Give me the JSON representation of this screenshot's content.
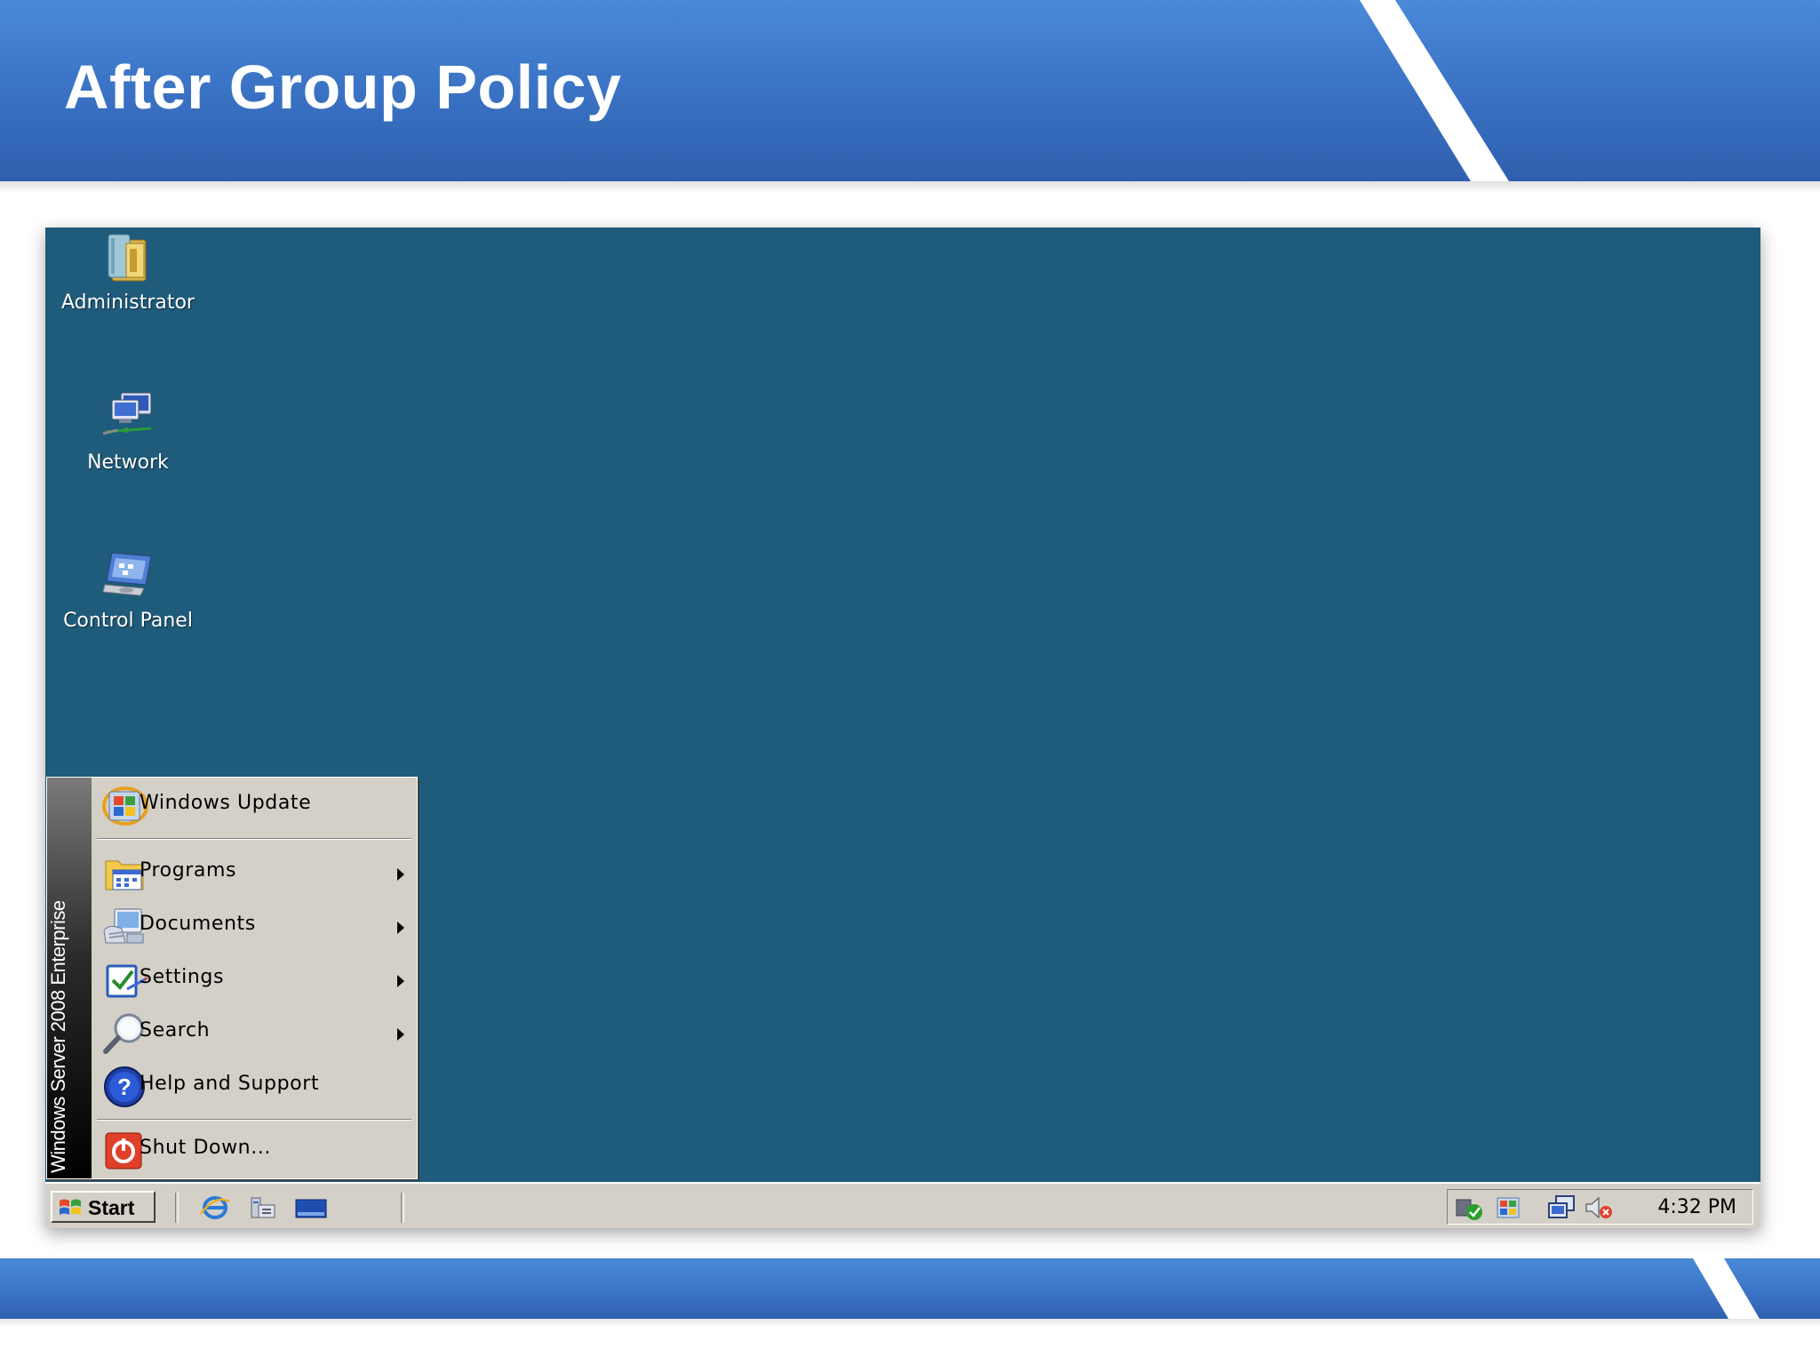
{
  "slide": {
    "title": "After Group Policy"
  },
  "desktop": {
    "background_color": "#1f5b7a",
    "icons": [
      {
        "label": "Administrator",
        "icon": "user-folder-icon"
      },
      {
        "label": "Network",
        "icon": "network-icon"
      },
      {
        "label": "Control Panel",
        "icon": "control-panel-icon"
      }
    ]
  },
  "start_menu": {
    "banner_text": "Windows Server 2008 Enterprise",
    "items": [
      {
        "label": "Windows Update",
        "icon": "windows-update-icon",
        "submenu": false
      },
      {
        "label": "Programs",
        "icon": "programs-icon",
        "submenu": true
      },
      {
        "label": "Documents",
        "icon": "documents-icon",
        "submenu": true
      },
      {
        "label": "Settings",
        "icon": "settings-icon",
        "submenu": true
      },
      {
        "label": "Search",
        "icon": "search-icon",
        "submenu": true
      },
      {
        "label": "Help and Support",
        "icon": "help-icon",
        "submenu": false
      },
      {
        "label": "Shut Down...",
        "icon": "shutdown-icon",
        "submenu": false
      }
    ]
  },
  "taskbar": {
    "start_label": "Start",
    "quick_launch": [
      "internet-explorer-icon",
      "server-manager-icon",
      "show-desktop-icon"
    ],
    "tray_icons": [
      "security-status-icon",
      "windows-update-tray-icon",
      "network-tray-icon",
      "volume-muted-icon"
    ],
    "clock": "4:32 PM"
  }
}
